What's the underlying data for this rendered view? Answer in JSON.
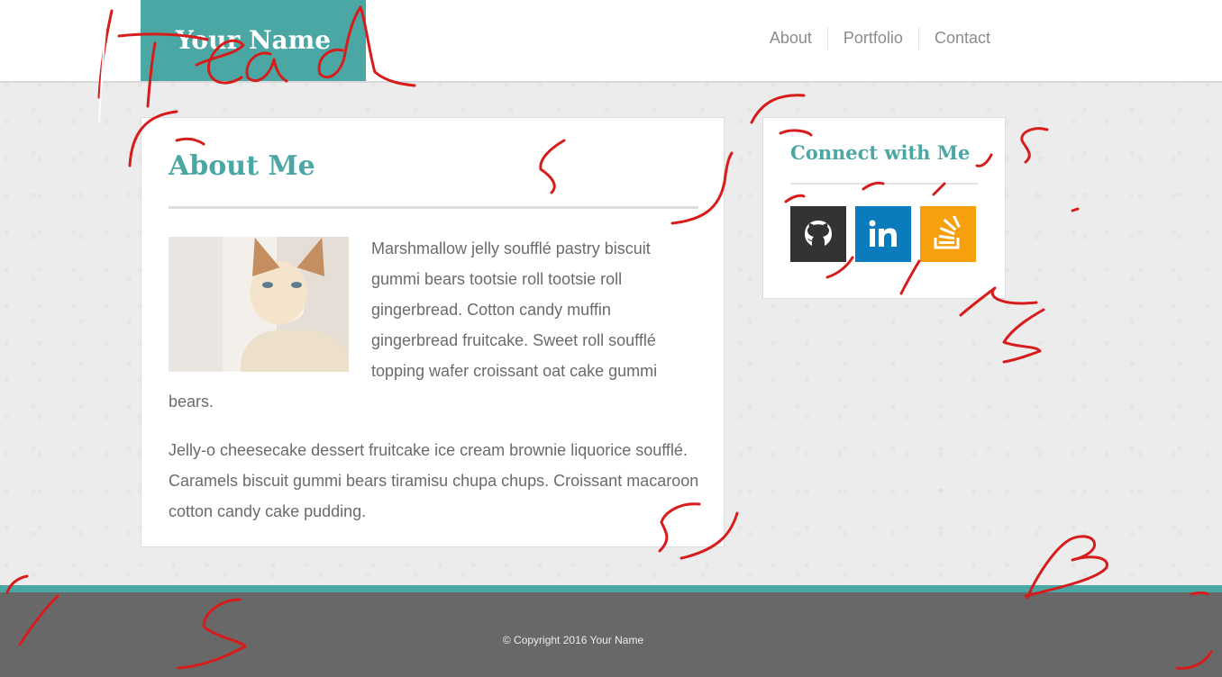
{
  "header": {
    "logo_text": "Your Name",
    "nav": [
      "About",
      "Portfolio",
      "Contact"
    ]
  },
  "about": {
    "title": "About Me",
    "paragraph1": "Marshmallow jelly soufflé pastry biscuit gummi bears tootsie roll tootsie roll gingerbread. Cotton candy muffin gingerbread fruitcake. Sweet roll soufflé topping wafer croissant oat cake gummi bears.",
    "paragraph2": "Jelly-o cheesecake dessert fruitcake ice cream brownie liquorice soufflé. Caramels biscuit gummi bears tiramisu chupa chups. Croissant macaroon cotton candy cake pudding.",
    "image": "cat-photo"
  },
  "connect": {
    "title": "Connect with Me",
    "icons": [
      "github-icon",
      "linkedin-icon",
      "stackoverflow-icon"
    ]
  },
  "footer": {
    "copyright": "© Copyright 2016 Your Name"
  },
  "colors": {
    "accent": "#4aa7a3",
    "footer": "#686868",
    "annotation": "#d71c1c"
  }
}
